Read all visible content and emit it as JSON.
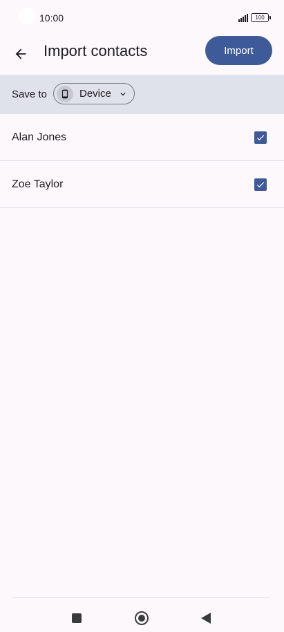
{
  "status_bar": {
    "time": "10:00",
    "battery": "100",
    "icons": [
      "camera-cutout",
      "signal-icon",
      "battery-icon"
    ]
  },
  "app_bar": {
    "back_icon": "arrow-back-icon",
    "title": "Import contacts",
    "import_label": "Import"
  },
  "save_to": {
    "label": "Save to",
    "chip": {
      "icon": "phone-icon",
      "value": "Device",
      "chevron_icon": "chevron-down-icon"
    }
  },
  "contacts": [
    {
      "name": "Alan Jones",
      "checked": true
    },
    {
      "name": "Zoe Taylor",
      "checked": true
    }
  ],
  "nav_bar": {
    "items": [
      "recents-square-icon",
      "home-circle-icon",
      "back-triangle-icon"
    ]
  },
  "colors": {
    "accent": "#3f5a98",
    "background": "#fcf8fc",
    "save_bar": "#dfe2eb",
    "chip_icon_bg": "#c6c9d2",
    "divider": "#dddde3"
  }
}
